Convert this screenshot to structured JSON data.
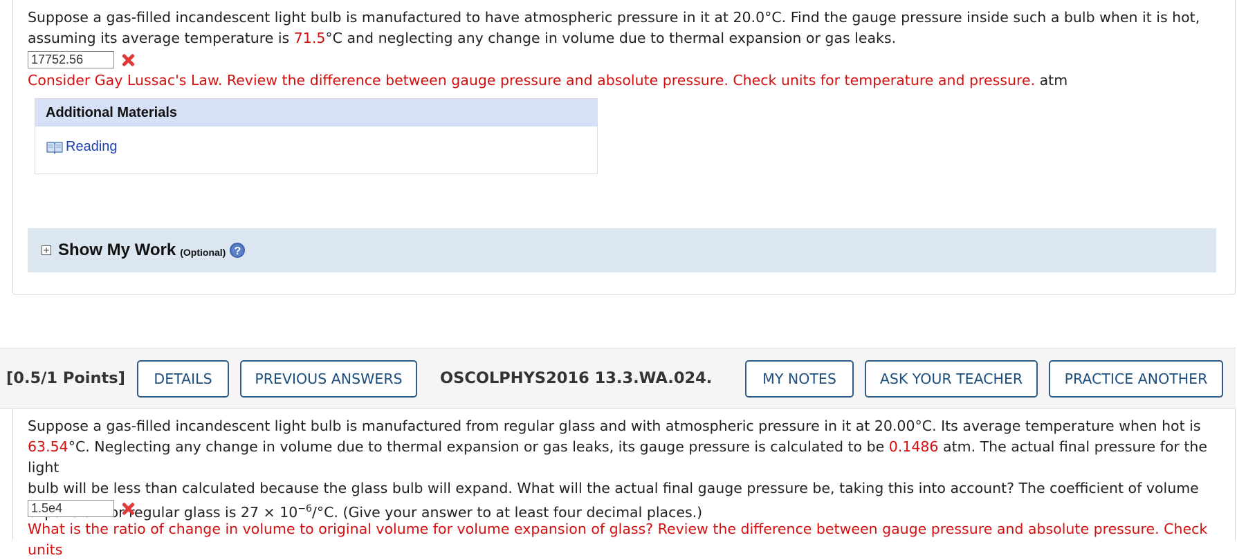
{
  "q1": {
    "text_line1": "Suppose a gas-filled incandescent light bulb is manufactured to have atmospheric pressure in it at 20.0°C. Find the gauge pressure inside such a bulb when it is hot,",
    "text_line2_a": "assuming its average temperature is ",
    "text_line2_red": "71.5",
    "text_line2_b": "°C and neglecting any change in volume due to thermal expansion or gas leaks.",
    "answer_value": "17752.56",
    "feedback": "Consider Gay Lussac's Law. Review the difference between gauge pressure and absolute pressure. Check units for temperature and pressure.",
    "unit": "atm",
    "additional_materials": {
      "title": "Additional Materials",
      "link_label": "Reading"
    },
    "show_my_work": {
      "title": "Show My Work",
      "optional": "(Optional)",
      "help_glyph": "?"
    }
  },
  "toolbar": {
    "points": "[0.5/1 Points]",
    "details": "DETAILS",
    "previous_answers": "PREVIOUS ANSWERS",
    "question_id": "OSCOLPHYS2016 13.3.WA.024.",
    "my_notes": "MY NOTES",
    "ask_teacher": "ASK YOUR TEACHER",
    "practice_another": "PRACTICE ANOTHER"
  },
  "q2": {
    "line1": "Suppose a gas-filled incandescent light bulb is manufactured from regular glass and with atmospheric pressure in it at 20.00°C. Its average temperature when hot is",
    "line2_red1": "63.54",
    "line2_a": "°C. Neglecting any change in volume due to thermal expansion or gas leaks, its gauge pressure is calculated to be ",
    "line2_red2": "0.1486",
    "line2_b": " atm. The actual final pressure for the light",
    "line3": "bulb will be less than calculated because the glass bulb will expand. What will the actual final gauge pressure be, taking this into account? The coefficient of volume",
    "line4_a": "expansion for regular glass is  27 × 10",
    "line4_sup": "−6",
    "line4_b": "/°C.  (Give your answer to at least four decimal places.)",
    "answer_value": "1.5e4",
    "feedback": "What is the ratio of change in volume to original volume for volume expansion of glass? Review the difference between gauge pressure and absolute pressure. Check units"
  },
  "colors": {
    "feedback_red": "#d40f0f",
    "button_border": "#2b5c8a",
    "header_bg": "#d6e0f6",
    "show_work_bg": "#dce6f0"
  }
}
